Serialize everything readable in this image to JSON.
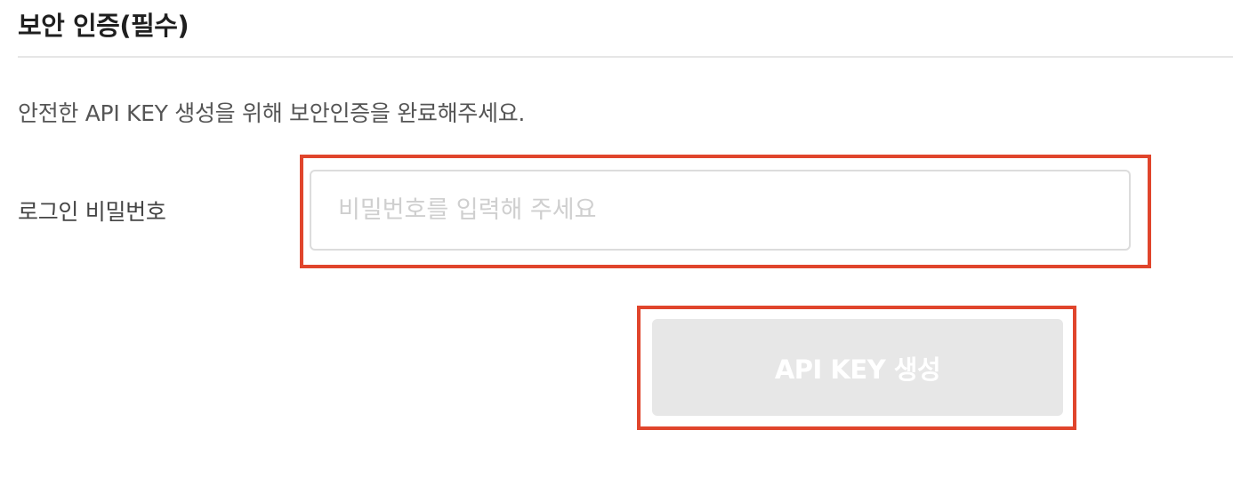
{
  "section": {
    "title": "보안 인증(필수)",
    "description": "안전한 API KEY 생성을 위해 보안인증을 완료해주세요."
  },
  "form": {
    "password_label": "로그인 비밀번호",
    "password_placeholder": "비밀번호를 입력해 주세요",
    "password_value": ""
  },
  "actions": {
    "generate_label": "API KEY 생성",
    "generate_enabled": false
  },
  "colors": {
    "highlight": "#e0452c",
    "button_disabled_bg": "#e7e7e7",
    "button_text": "#ffffff",
    "placeholder": "#cfcfcf",
    "divider": "#e6e6e6"
  }
}
